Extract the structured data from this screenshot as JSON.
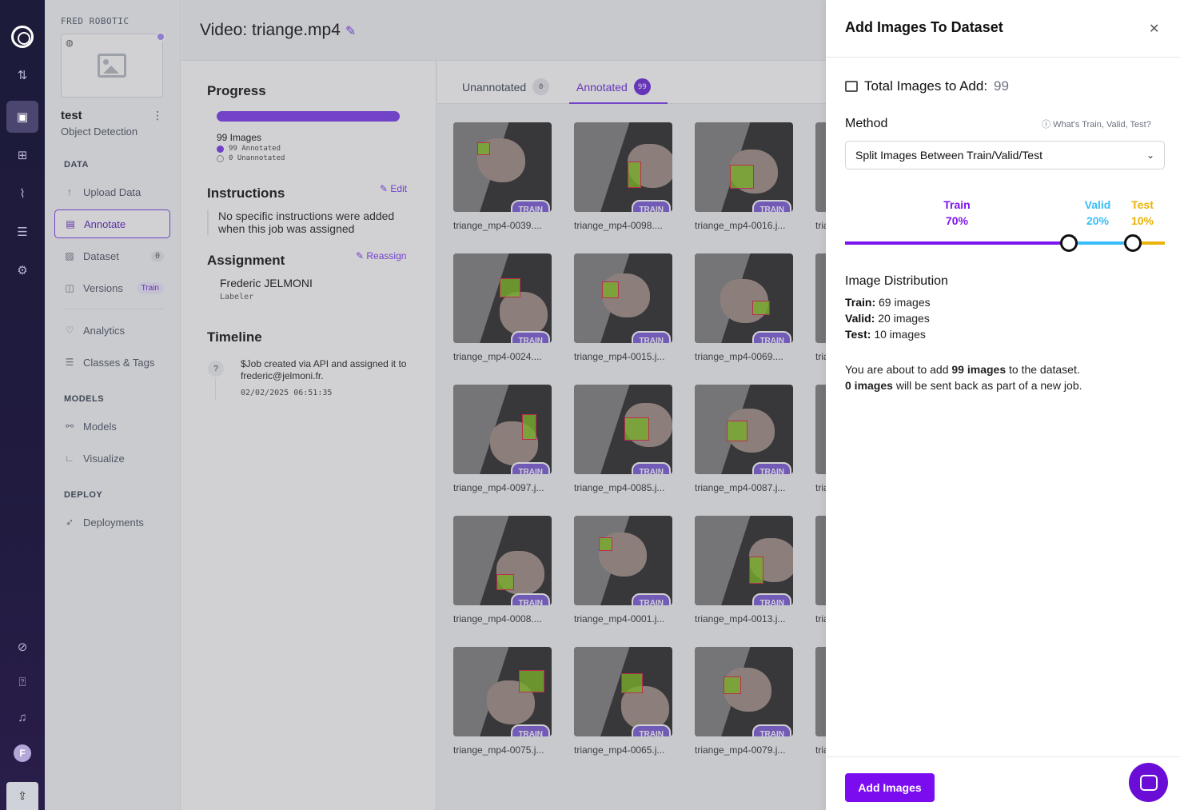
{
  "workspace": "FRED ROBOTIC",
  "project": {
    "name": "test",
    "type": "Object Detection"
  },
  "sidebar": {
    "sections": {
      "data": "DATA",
      "models": "MODELS",
      "deploy": "DEPLOY"
    },
    "items": [
      {
        "label": "Upload Data",
        "icon": "upload-arrow-icon"
      },
      {
        "label": "Annotate",
        "icon": "annotate-icon"
      },
      {
        "label": "Dataset",
        "icon": "dataset-icon",
        "badge": "0"
      },
      {
        "label": "Versions",
        "icon": "versions-icon",
        "badge": "Train"
      },
      {
        "label": "Analytics",
        "icon": "analytics-icon"
      },
      {
        "label": "Classes & Tags",
        "icon": "list-icon"
      },
      {
        "label": "Models",
        "icon": "models-icon"
      },
      {
        "label": "Visualize",
        "icon": "chart-icon"
      },
      {
        "label": "Deployments",
        "icon": "rocket-icon"
      }
    ]
  },
  "rail": {
    "avatar_letter": "F"
  },
  "main": {
    "title": "Video: triange.mp4",
    "progress": {
      "heading": "Progress",
      "images": "99 Images",
      "annotated": "99 Annotated",
      "unannotated": "0 Unannotated",
      "fraction": 1.0
    },
    "instructions": {
      "heading": "Instructions",
      "edit_label": "Edit",
      "text": "No specific instructions were added when this job was assigned"
    },
    "assignment": {
      "heading": "Assignment",
      "reassign_label": "Reassign",
      "name": "Frederic JELMONI",
      "role": "Labeler"
    },
    "timeline": {
      "heading": "Timeline",
      "marker": "?",
      "text": "$Job created via API and assigned it to frederic@jelmoni.fr.",
      "time": "02/02/2025 06:51:35"
    },
    "tabs": [
      {
        "label": "Unannotated",
        "count": "0"
      },
      {
        "label": "Annotated",
        "count": "99"
      }
    ],
    "badge_label": "TRAIN",
    "cards": [
      "triange_mp4-0039....",
      "triange_mp4-0098....",
      "triange_mp4-0016.j...",
      "tria",
      "triange_mp4-0024....",
      "triange_mp4-0015.j...",
      "triange_mp4-0069....",
      "tria",
      "triange_mp4-0097.j...",
      "triange_mp4-0085.j...",
      "triange_mp4-0087.j...",
      "tria",
      "triange_mp4-0008....",
      "triange_mp4-0001.j...",
      "triange_mp4-0013.j...",
      "tria",
      "triange_mp4-0075.j...",
      "triange_mp4-0065.j...",
      "triange_mp4-0079.j...",
      "tria"
    ]
  },
  "panel": {
    "title": "Add Images To Dataset",
    "total_label": "Total Images to Add:",
    "total_value": "99",
    "method_label": "Method",
    "help_link": "What's Train, Valid, Test?",
    "method_value": "Split Images Between Train/Valid/Test",
    "split": {
      "train": {
        "name": "Train",
        "pct": "70%",
        "value": 70,
        "color": "#7c14f0"
      },
      "valid": {
        "name": "Valid",
        "pct": "20%",
        "value": 20,
        "color": "#38bdf8"
      },
      "test": {
        "name": "Test",
        "pct": "10%",
        "value": 10,
        "color": "#eab308"
      }
    },
    "distribution_heading": "Image Distribution",
    "distribution": [
      {
        "label": "Train:",
        "value": "69 images"
      },
      {
        "label": "Valid:",
        "value": "20 images"
      },
      {
        "label": "Test:",
        "value": "10 images"
      }
    ],
    "note1_pre": "You are about to add ",
    "note1_bold": "99 images",
    "note1_post": " to the dataset.",
    "note2_bold": "0 images",
    "note2_post": " will be sent back as part of a new job.",
    "add_button": "Add Images"
  }
}
